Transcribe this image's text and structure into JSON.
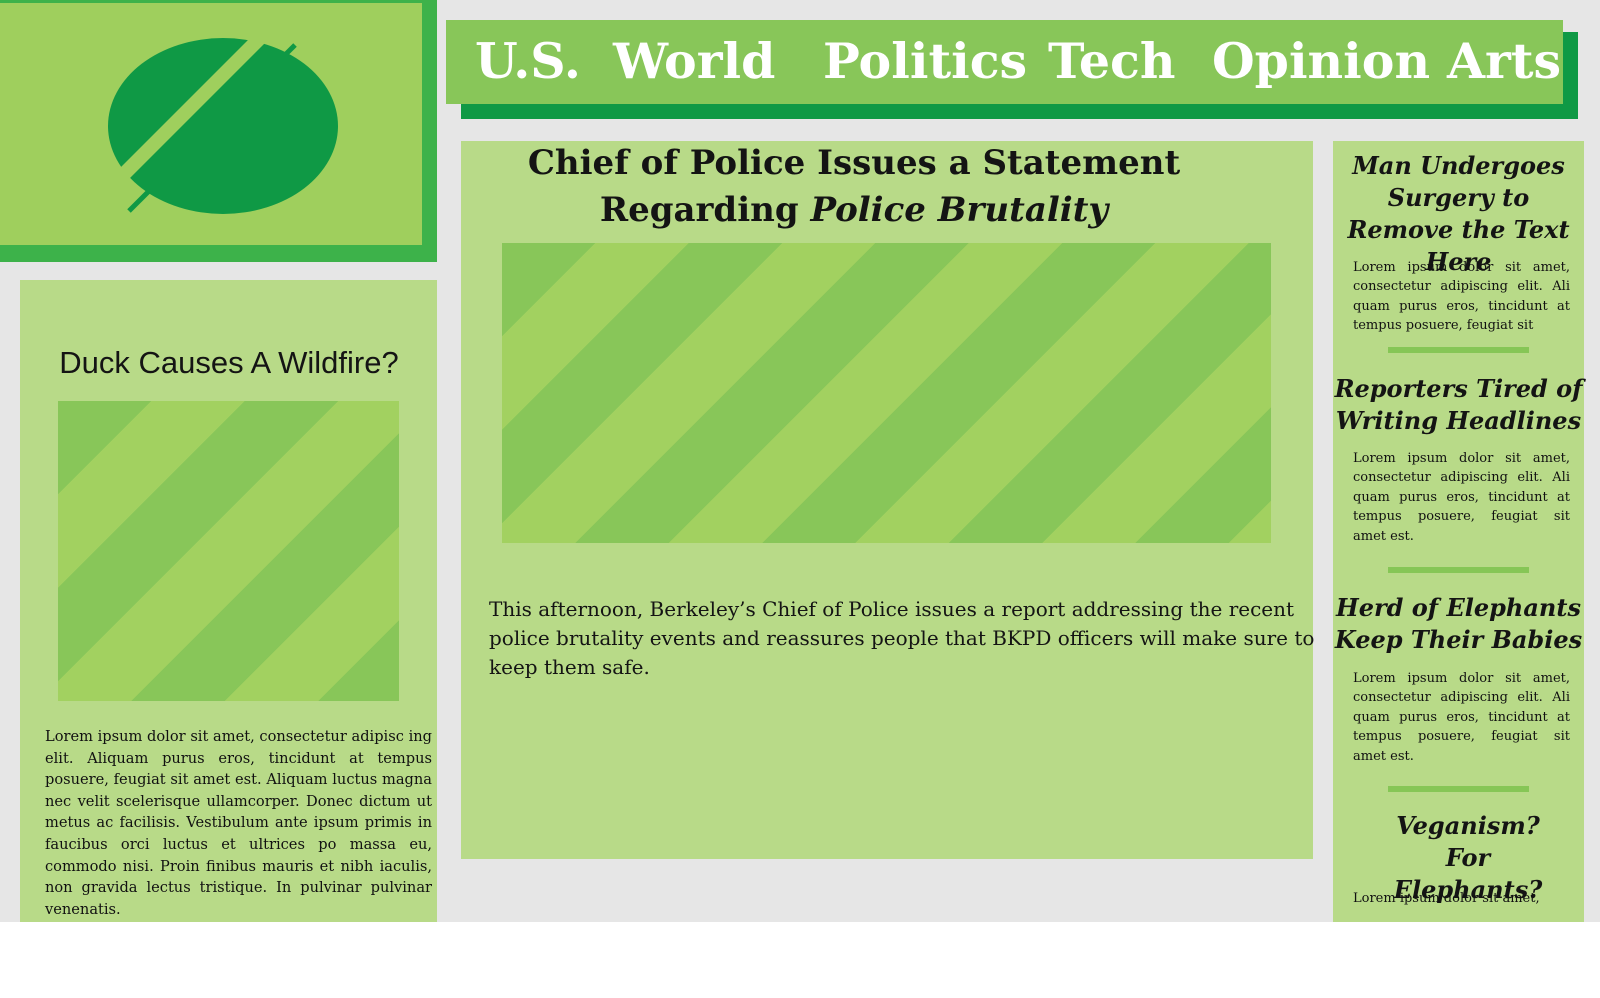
{
  "brand": {
    "logo_icon": "circle-slash-logo-icon",
    "colors": {
      "dark_green": "#0f9945",
      "bright_green": "#3db24a",
      "mid_green": "#88c659",
      "light_green": "#9fcf5d",
      "pale_green": "#b8da88",
      "background": "#e6e6e6"
    }
  },
  "nav": {
    "items": [
      "U.S.",
      "World",
      "Politics",
      "Tech",
      "Opinion",
      "Arts"
    ]
  },
  "left_story": {
    "title": "Duck Causes A Wildfire?",
    "image_icon": "image-placeholder-icon",
    "body": "Lorem ipsum dolor sit amet, consectetur adipisc ing elit. Aliquam purus eros, tincidunt at tempus posuere, feugiat sit amet est. Aliquam luctus magna nec velit scelerisque ullamcorper. Donec dictum ut metus ac facilisis. Vestibulum ante ipsum primis in faucibus orci luctus et ultrices po massa eu, commodo nisi. Proin finibus mauris et nibh iaculis, non gravida lectus tristique. In pulvinar pulvinar venenatis."
  },
  "main_story": {
    "title_plain": "Chief of Police Issues a Statement Regarding ",
    "title_italic": "Police Brutality",
    "image_icon": "image-placeholder-icon",
    "body": "This afternoon, Berkeley’s Chief of Police issues a report addressing the recent police brutality events and reassures people that BKPD officers will make sure to keep them safe."
  },
  "sidebar": {
    "items": [
      {
        "title": "Man Undergoes Surgery to Remove the Text Here",
        "body": "Lorem ipsum dolor sit amet, consectetur adipiscing elit. Ali quam purus eros, tincidunt at tempus posuere, feugiat sit"
      },
      {
        "title": "Reporters Tired of Writing Headlines",
        "body": "Lorem ipsum dolor sit amet, consectetur adipiscing elit. Ali quam purus eros, tincidunt at tempus posuere, feugiat sit amet est."
      },
      {
        "title": "Herd of Elephants Keep Their Babies",
        "body": "Lorem ipsum dolor sit amet, consectetur adipiscing elit. Ali quam purus eros, tincidunt at tempus posuere, feugiat sit amet est."
      },
      {
        "title": "Veganism? For Elephants?",
        "body": "Lorem ipsum dolor sit amet,"
      }
    ]
  }
}
